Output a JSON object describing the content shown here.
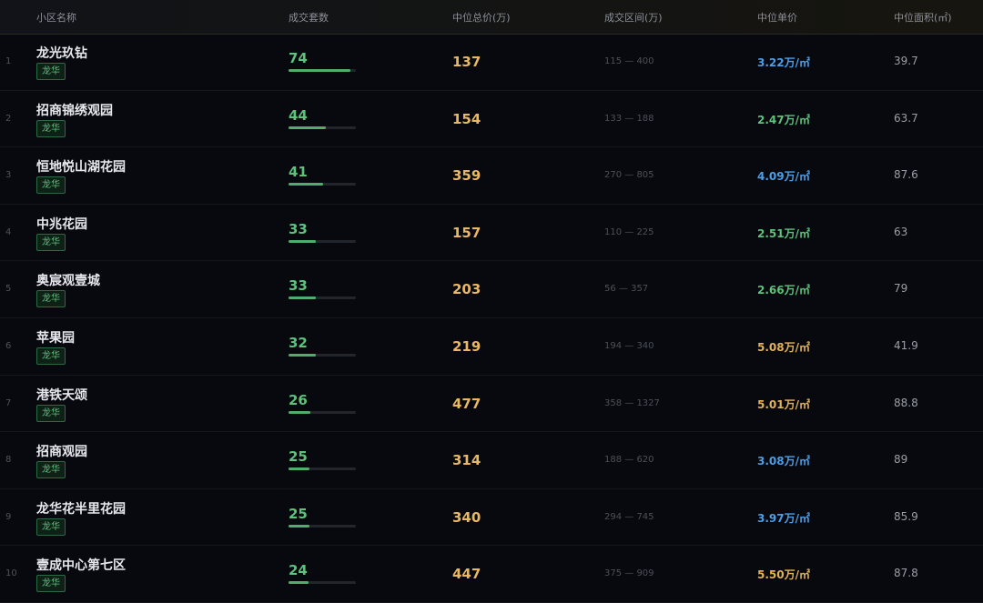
{
  "header": {
    "col_name": "小区名称",
    "col_count": "成交套数",
    "col_total": "中位总价(万)",
    "col_range": "成交区间(万)",
    "col_unit": "中位单价",
    "col_area": "中位面积(㎡)"
  },
  "colors": {
    "count_green": "#5cc27c",
    "total_gold": "#e9b865",
    "unit_blue": "#4c9ee8",
    "unit_green": "#5cc27c",
    "unit_gold": "#e2b25c"
  },
  "rows": [
    {
      "rank": "1",
      "name": "龙光玖钻",
      "district": "龙华",
      "count": "74",
      "count_fraction": 0.92,
      "total": "137",
      "range": "115 — 400",
      "unit_price": "3.22万/㎡",
      "unit_color": "blue",
      "area": "39.7"
    },
    {
      "rank": "2",
      "name": "招商锦绣观园",
      "district": "龙华",
      "count": "44",
      "count_fraction": 0.55,
      "total": "154",
      "range": "133 — 188",
      "unit_price": "2.47万/㎡",
      "unit_color": "green",
      "area": "63.7"
    },
    {
      "rank": "3",
      "name": "恒地悦山湖花园",
      "district": "龙华",
      "count": "41",
      "count_fraction": 0.51,
      "total": "359",
      "range": "270 — 805",
      "unit_price": "4.09万/㎡",
      "unit_color": "blue",
      "area": "87.6"
    },
    {
      "rank": "4",
      "name": "中兆花园",
      "district": "龙华",
      "count": "33",
      "count_fraction": 0.41,
      "total": "157",
      "range": "110 — 225",
      "unit_price": "2.51万/㎡",
      "unit_color": "green",
      "area": "63"
    },
    {
      "rank": "5",
      "name": "奥宸观壹城",
      "district": "龙华",
      "count": "33",
      "count_fraction": 0.41,
      "total": "203",
      "range": "56 — 357",
      "unit_price": "2.66万/㎡",
      "unit_color": "green",
      "area": "79"
    },
    {
      "rank": "6",
      "name": "苹果园",
      "district": "龙华",
      "count": "32",
      "count_fraction": 0.4,
      "total": "219",
      "range": "194 — 340",
      "unit_price": "5.08万/㎡",
      "unit_color": "gold",
      "area": "41.9"
    },
    {
      "rank": "7",
      "name": "港铁天颂",
      "district": "龙华",
      "count": "26",
      "count_fraction": 0.32,
      "total": "477",
      "range": "358 — 1327",
      "unit_price": "5.01万/㎡",
      "unit_color": "gold",
      "area": "88.8"
    },
    {
      "rank": "8",
      "name": "招商观园",
      "district": "龙华",
      "count": "25",
      "count_fraction": 0.31,
      "total": "314",
      "range": "188 — 620",
      "unit_price": "3.08万/㎡",
      "unit_color": "blue",
      "area": "89"
    },
    {
      "rank": "9",
      "name": "龙华花半里花园",
      "district": "龙华",
      "count": "25",
      "count_fraction": 0.31,
      "total": "340",
      "range": "294 — 745",
      "unit_price": "3.97万/㎡",
      "unit_color": "blue",
      "area": "85.9"
    },
    {
      "rank": "10",
      "name": "壹成中心第七区",
      "district": "龙华",
      "count": "24",
      "count_fraction": 0.3,
      "total": "447",
      "range": "375 — 909",
      "unit_price": "5.50万/㎡",
      "unit_color": "gold",
      "area": "87.8"
    }
  ]
}
